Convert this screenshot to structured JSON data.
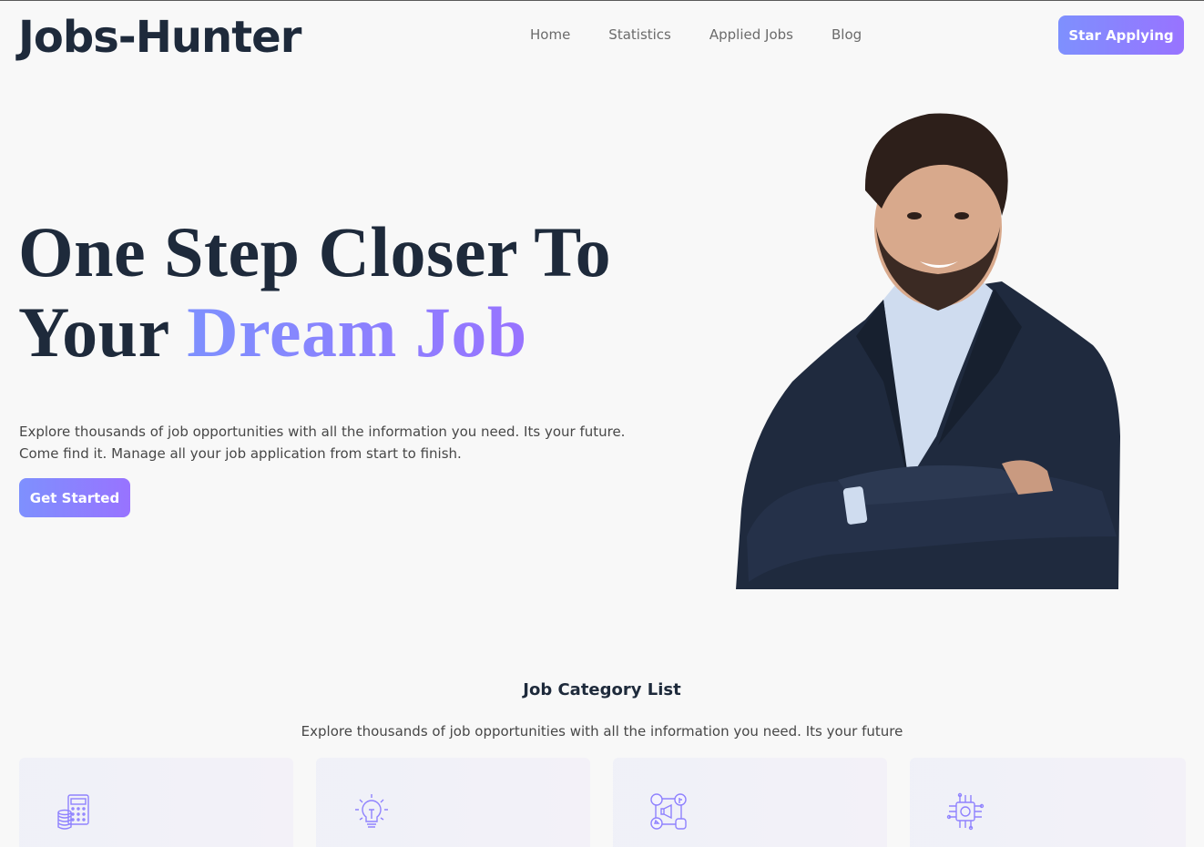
{
  "navbar": {
    "brand": "Jobs-Hunter",
    "links": [
      "Home",
      "Statistics",
      "Applied Jobs",
      "Blog"
    ],
    "cta_label": "Star Applying"
  },
  "hero": {
    "title_line1": "One Step Closer To",
    "title_line2_plain": "Your ",
    "title_line2_accent": "Dream Job",
    "description": "Explore thousands of job opportunities with all the information you need. Its your future. Come find it. Manage all your job application from start to finish.",
    "cta_label": "Get Started",
    "photo": "smiling-man-in-blazer-arms-crossed"
  },
  "categories": {
    "title": "Job Category List",
    "subtitle": "Explore thousands of job opportunities with all the information you need. Its your future",
    "items": [
      {
        "icon": "accounts-calculator-icon"
      },
      {
        "icon": "lightbulb-idea-icon"
      },
      {
        "icon": "social-media-marketing-icon"
      },
      {
        "icon": "chip-engineering-icon"
      }
    ]
  },
  "colors": {
    "accent_start": "#7e90fe",
    "accent_end": "#9873ff",
    "heading": "#1e2a3b",
    "background": "#f8f8f8"
  }
}
